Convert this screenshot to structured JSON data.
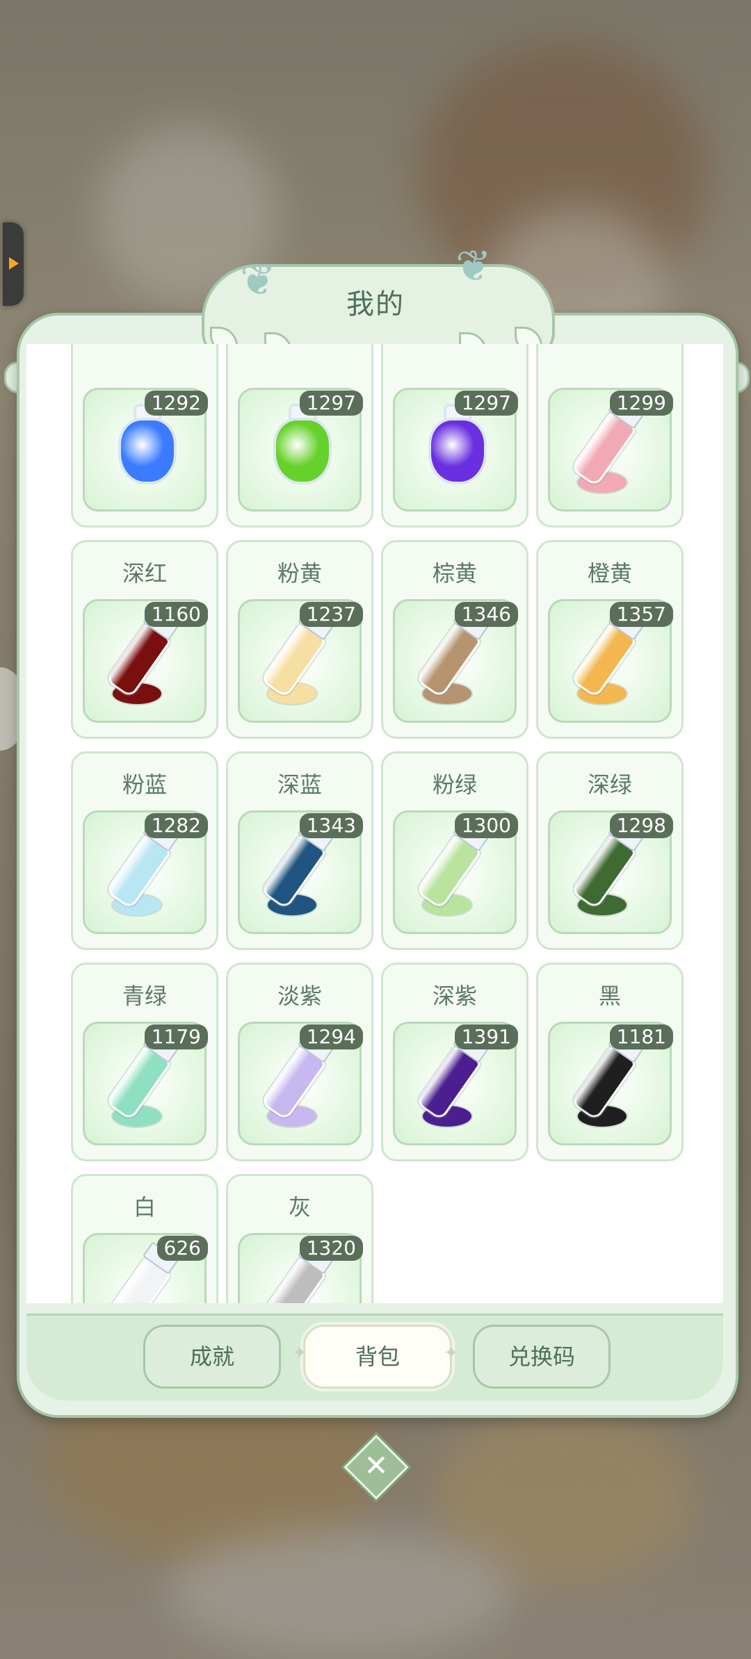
{
  "title": "我的",
  "items": [
    {
      "name": "",
      "count": "1292",
      "kind": "bottle",
      "color": "#3a7bff"
    },
    {
      "name": "",
      "count": "1297",
      "kind": "bottle",
      "color": "#66d12a"
    },
    {
      "name": "",
      "count": "1297",
      "kind": "bottle",
      "color": "#6a2fe0"
    },
    {
      "name": "",
      "count": "1299",
      "kind": "tube",
      "color": "#f2a9b6"
    },
    {
      "name": "深红",
      "count": "1160",
      "kind": "tube",
      "color": "#7a0f0f"
    },
    {
      "name": "粉黄",
      "count": "1237",
      "kind": "tube",
      "color": "#f6dfa2"
    },
    {
      "name": "棕黄",
      "count": "1346",
      "kind": "tube",
      "color": "#b79470"
    },
    {
      "name": "橙黄",
      "count": "1357",
      "kind": "tube",
      "color": "#f2b84f"
    },
    {
      "name": "粉蓝",
      "count": "1282",
      "kind": "tube",
      "color": "#b9e6f3"
    },
    {
      "name": "深蓝",
      "count": "1343",
      "kind": "tube",
      "color": "#1f5580"
    },
    {
      "name": "粉绿",
      "count": "1300",
      "kind": "tube",
      "color": "#b9e39e"
    },
    {
      "name": "深绿",
      "count": "1298",
      "kind": "tube",
      "color": "#3f6b33"
    },
    {
      "name": "青绿",
      "count": "1179",
      "kind": "tube",
      "color": "#8fe0c2"
    },
    {
      "name": "淡紫",
      "count": "1294",
      "kind": "tube",
      "color": "#c7b8f0"
    },
    {
      "name": "深紫",
      "count": "1391",
      "kind": "tube",
      "color": "#4b1f8f"
    },
    {
      "name": "黑",
      "count": "1181",
      "kind": "tube",
      "color": "#1f1f1f"
    },
    {
      "name": "白",
      "count": "626",
      "kind": "tube",
      "color": "#f1f3f5"
    },
    {
      "name": "灰",
      "count": "1320",
      "kind": "tube",
      "color": "#bdbdbd"
    }
  ],
  "tabs": [
    {
      "label": "成就",
      "active": false
    },
    {
      "label": "背包",
      "active": true
    },
    {
      "label": "兑换码",
      "active": false
    }
  ],
  "colors": {
    "accent": "#a8c6a8",
    "text": "#5c7a63",
    "badge": "#5a6e5a"
  }
}
